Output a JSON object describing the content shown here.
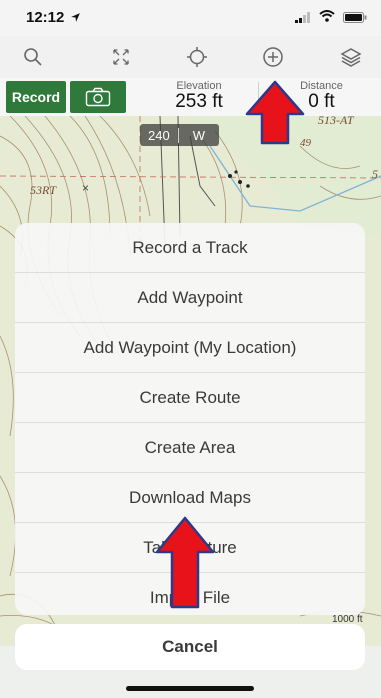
{
  "status_bar": {
    "time": "12:12",
    "icons": [
      "location-arrow-icon",
      "signal-icon",
      "wifi-icon",
      "battery-icon"
    ]
  },
  "toolbar": {
    "icons": [
      "search-icon",
      "expand-icon",
      "locate-icon",
      "add-icon",
      "layers-icon"
    ]
  },
  "stats": {
    "record_label": "Record",
    "camera_icon": "camera-icon",
    "elevation_label": "Elevation",
    "elevation_value": "253 ft",
    "distance_label": "Distance",
    "distance_value": "0 ft"
  },
  "map": {
    "overlay_left": "240",
    "overlay_right": "W",
    "labels": [
      "513-AT",
      "49",
      "53RT",
      "×",
      "5"
    ],
    "scale_label": "1000 ft"
  },
  "sheet": {
    "items": [
      "Record a Track",
      "Add Waypoint",
      "Add Waypoint (My Location)",
      "Create Route",
      "Create Area",
      "Download Maps",
      "Take Picture",
      "Import File"
    ],
    "cancel": "Cancel"
  },
  "colors": {
    "brand_green": "#2f7a3a",
    "annotation_red": "#e8121b",
    "annotation_outline": "#2a3a8c"
  }
}
